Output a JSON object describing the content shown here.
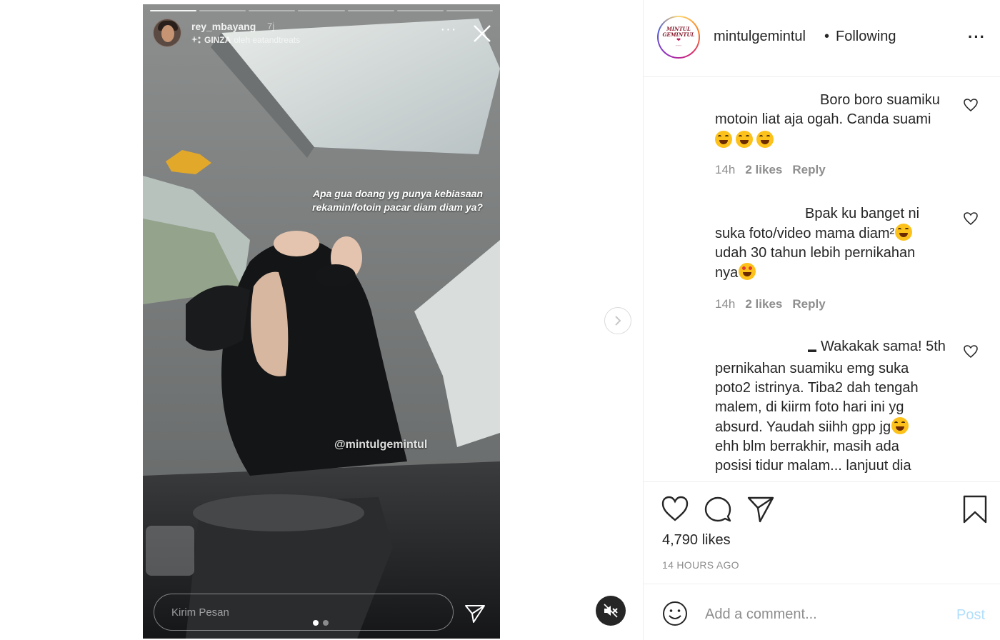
{
  "story": {
    "username": "rey_mbayang",
    "age": "7j",
    "music_prefix": "GINZA",
    "music_suffix": "oleh eatandtreats",
    "overlay_line1": "Apa gua doang yg punya kebiasaan",
    "overlay_line2": "rekamin/fotoin pacar diam diam ya?",
    "watermark": "@mintulgemintul",
    "reply_placeholder": "Kirim Pesan",
    "progress_total": 7,
    "progress_done": 1,
    "slides_total": 2,
    "slides_active": 1
  },
  "header": {
    "username": "mintulgemintul",
    "separator": "•",
    "follow_status": "Following",
    "logo_text_line1": "MINTUL",
    "logo_text_line2": "GEMINTUL"
  },
  "comments": [
    {
      "lines": [
        "Boro boro suamiku",
        "motoin liat aja ogah. Canda suami"
      ],
      "emoji_count": 3,
      "time": "14h",
      "likes": "2 likes",
      "reply": "Reply"
    },
    {
      "lines": [
        "Bpak ku banget ni",
        "suka foto/video mama diam²",
        "udah 30 tahun lebih pernikahan",
        "nya"
      ],
      "time": "14h",
      "likes": "2 likes",
      "reply": "Reply"
    },
    {
      "lines": [
        "Wakakak sama! 5th",
        "pernikahan suamiku emg suka",
        "poto2 istrinya. Tiba2 dah tengah",
        "malem, di kiirm foto hari ini yg",
        "absurd. Yaudah siihh gpp jg",
        "ehh blm berrakhir, masih ada",
        "posisi tidur malam... lanjuut dia"
      ]
    }
  ],
  "post": {
    "likes": "4,790 likes",
    "time": "14 HOURS AGO",
    "comment_placeholder": "Add a comment...",
    "post_label": "Post"
  },
  "colors": {
    "text": "#262626",
    "muted": "#8e8e8e",
    "border": "#efefef",
    "post_disabled": "#b2dffc"
  },
  "icons": [
    "close-icon",
    "more-icon",
    "send-icon",
    "chevron-right-icon",
    "mute-icon",
    "heart-icon",
    "comment-icon",
    "bookmark-icon",
    "smile-icon"
  ]
}
